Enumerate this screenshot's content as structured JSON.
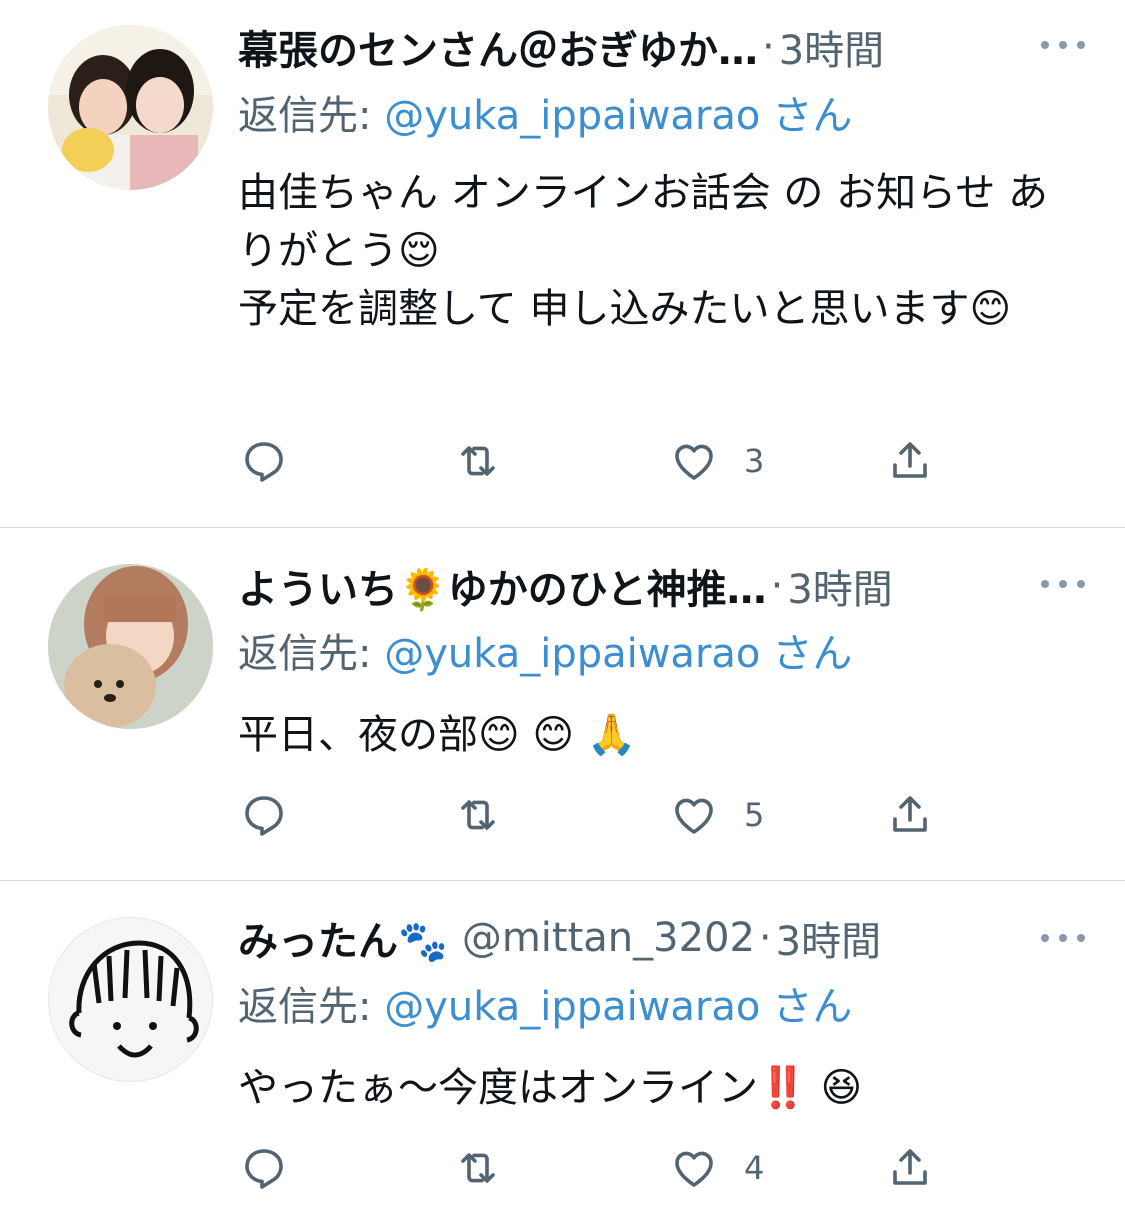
{
  "colors": {
    "text": "#0f1419",
    "muted": "#536471",
    "link": "#3b8ed0",
    "divider": "#dcdcdc"
  },
  "tweets": [
    {
      "name": "幕張のセンさん＠おぎゆか…",
      "handle": "",
      "dot": "·",
      "time": "3時間",
      "reply_prefix": "返信先: ",
      "reply_mention": "@yuka_ippaiwarao",
      "reply_suffix": "さん",
      "body": "由佳ちゃん オンラインお話会 の お知らせ ありがとう😌\n予定を調整して 申し込みたいと思います😊",
      "likes": "3",
      "avatar_icon": "avatar-photo-two-girls"
    },
    {
      "name": "よういち🌻ゆかのひと神推…",
      "handle": "",
      "dot": "·",
      "time": "3時間",
      "reply_prefix": "返信先: ",
      "reply_mention": "@yuka_ippaiwarao",
      "reply_suffix": "さん",
      "body": "平日、夜の部😊 😊 🙏",
      "likes": "5",
      "avatar_icon": "avatar-photo-girl-with-dog"
    },
    {
      "name": "みったん🐾",
      "handle": "@mittan_3202",
      "dot": "·",
      "time": "3時間",
      "reply_prefix": "返信先: ",
      "reply_mention": "@yuka_ippaiwarao",
      "reply_suffix": "さん",
      "body": "やったぁ〜今度はオンライン‼️ 😆",
      "likes": "4",
      "avatar_icon": "avatar-drawing-face"
    }
  ]
}
